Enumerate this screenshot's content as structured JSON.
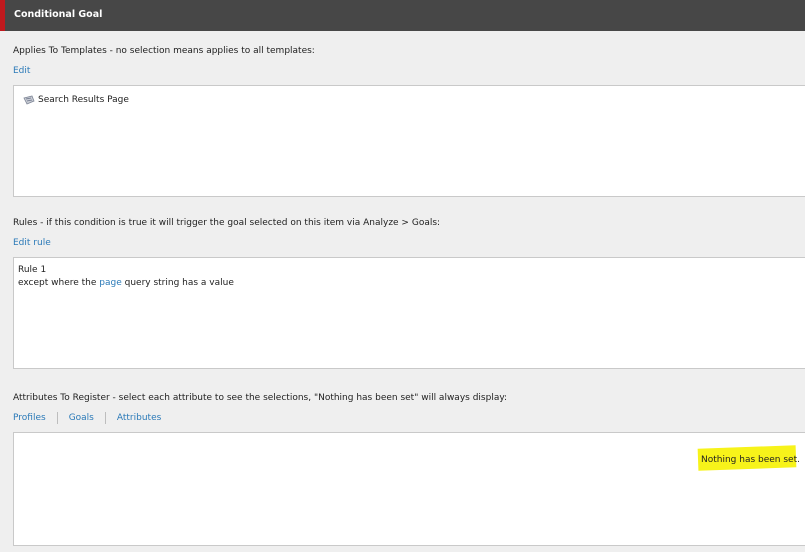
{
  "header": {
    "title": "Conditional Goal",
    "accent_color": "#c0191e"
  },
  "templates_section": {
    "label": "Applies To Templates - no selection means applies to all templates:",
    "edit_link": "Edit",
    "items": [
      {
        "label": "Search Results Page",
        "icon": "template-icon"
      }
    ]
  },
  "rules_section": {
    "label": "Rules - if this condition is true it will trigger the goal selected on this item via Analyze > Goals:",
    "edit_link": "Edit rule",
    "rule_title": "Rule 1",
    "rule_prefix": "except where the ",
    "rule_link": "page",
    "rule_suffix": " query string has a value"
  },
  "attributes_section": {
    "label": "Attributes To Register - select each attribute to see the selections, \"Nothing has been set\" will always display:",
    "tabs": [
      "Profiles",
      "Goals",
      "Attributes"
    ],
    "empty_message": "Nothing has been set.",
    "highlight_color": "#f7f31a"
  }
}
